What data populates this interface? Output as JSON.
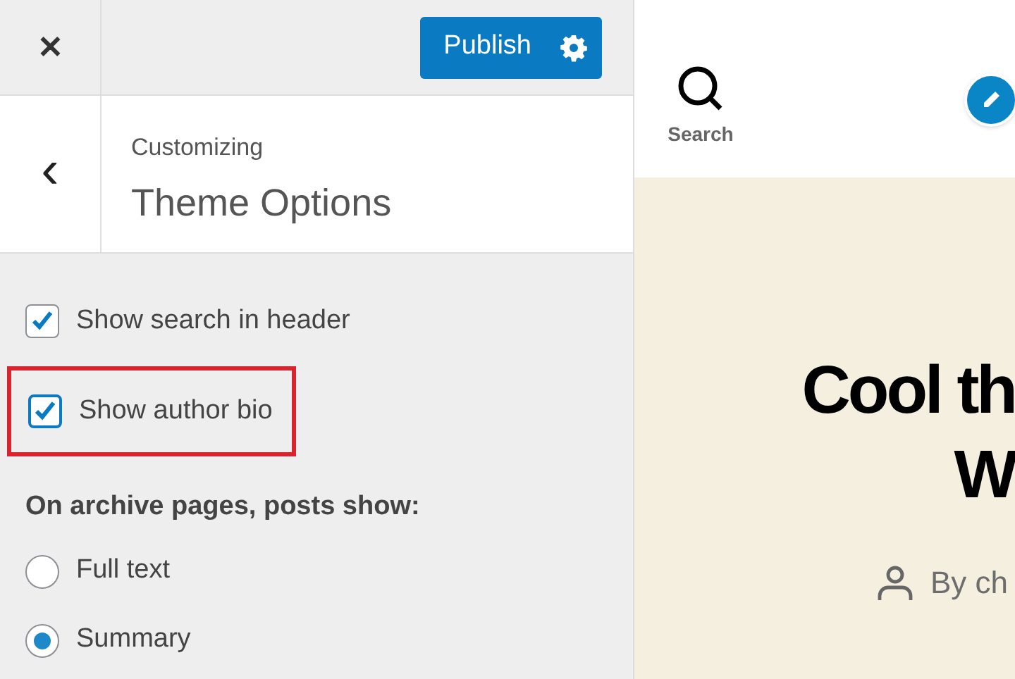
{
  "header": {
    "close_symbol": "✕",
    "publish_label": "Publish"
  },
  "section": {
    "back_symbol": "‹",
    "breadcrumb": "Customizing",
    "title": "Theme Options"
  },
  "options": [
    {
      "kind": "checkbox",
      "label": "Show search in header",
      "checked": true,
      "highlighted": false
    },
    {
      "kind": "checkbox",
      "label": "Show author bio",
      "checked": true,
      "highlighted": true
    }
  ],
  "archive": {
    "heading": "On archive pages, posts show:",
    "choices": [
      {
        "label": "Full text",
        "selected": false
      },
      {
        "label": "Summary",
        "selected": true
      }
    ]
  },
  "preview": {
    "search_label": "Search",
    "title_lines": [
      "Cool th",
      "W"
    ],
    "byline": "By ch"
  }
}
